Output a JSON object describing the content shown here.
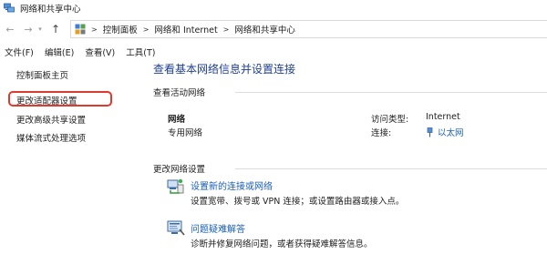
{
  "window": {
    "title": "网络和共享中心"
  },
  "breadcrumb": [
    "控制面板",
    "网络和 Internet",
    "网络和共享中心"
  ],
  "menu": [
    "文件(F)",
    "编辑(E)",
    "查看(V)",
    "工具(T)"
  ],
  "sidebar": {
    "items": [
      {
        "label": "控制面板主页"
      },
      {
        "label": "更改适配器设置",
        "highlighted": true
      },
      {
        "label": "更改高级共享设置"
      },
      {
        "label": "媒体流式处理选项"
      }
    ]
  },
  "main": {
    "title": "查看基本网络信息并设置连接",
    "active_networks_heading": "查看活动网络",
    "network": {
      "name": "网络",
      "type": "专用网络",
      "access_type_label": "访问类型:",
      "access_type_value": "Internet",
      "connections_label": "连接:",
      "connections_value": "以太网"
    },
    "change_settings_heading": "更改网络设置",
    "tasks": [
      {
        "link": "设置新的连接或网络",
        "description": "设置宽带、拨号或 VPN 连接；或设置路由器或接入点。",
        "icon": "network-setup-icon"
      },
      {
        "link": "问题疑难解答",
        "description": "诊断并修复网络问题，或者获得疑难解答信息。",
        "icon": "troubleshoot-icon"
      }
    ]
  },
  "colors": {
    "link": "#1a5fb4",
    "title": "#1f3f8f",
    "highlight_ring": "#e0392d"
  }
}
